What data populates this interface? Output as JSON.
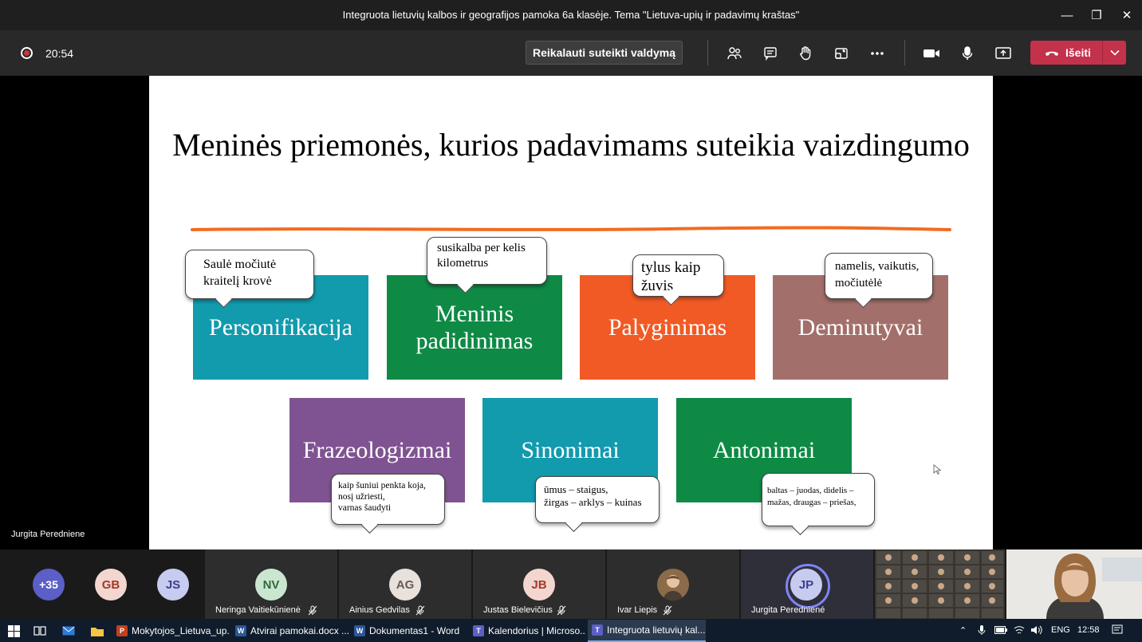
{
  "window": {
    "title": "Integruota lietuvių kalbos ir geografijos pamoka 6a klasėje. Tema \"Lietuva-upių ir padavimų kraštas\"",
    "minimize": "—",
    "maximize": "❐",
    "close": "✕"
  },
  "meeting": {
    "timer": "20:54",
    "request_control_label": "Reikalauti suteikti valdymą",
    "leave_label": "Išeiti"
  },
  "slide": {
    "title": "Meninės priemonės, kurios padavimams suteikia vaizdingumo",
    "boxes": [
      {
        "label": "Personifikacija",
        "color": "#129aad"
      },
      {
        "label": "Meninis padidinimas",
        "color": "#0e8a45"
      },
      {
        "label": "Palyginimas",
        "color": "#f15a24"
      },
      {
        "label": "Deminutyvai",
        "color": "#a36f6a"
      },
      {
        "label": "Frazeologizmai",
        "color": "#7f5391"
      },
      {
        "label": "Sinonimai",
        "color": "#129aad"
      },
      {
        "label": "Antonimai",
        "color": "#0e8a45"
      }
    ],
    "bubbles": [
      "Saulė močiutė\nkraitelį krovė",
      "susikalba per kelis\nkilometrus",
      "tylus kaip\nžuvis",
      "namelis, vaikutis,\nmočiutėlė",
      "kaip šuniui penkta koja,\nnosį užriesti,\nvarnas šaudyti",
      "ūmus – staigus,\nžirgas – arklys – kuinas",
      "baltas – juodas, didelis –\nmažas, draugas – priešas,"
    ],
    "underline_color": "#f26b21"
  },
  "presenter_name": "Jurgita Peredniene",
  "participants": {
    "more_count": "+35",
    "avatars": [
      {
        "initials": "GB",
        "bg": "#f3d6cf",
        "fg": "#a23a2a"
      },
      {
        "initials": "JS",
        "bg": "#c7cbef",
        "fg": "#3a3e8f"
      }
    ],
    "tiles": [
      {
        "initials": "NV",
        "name": "Neringa Vaitiekūnienė",
        "bg": "#cbe6d0",
        "fg": "#2e6a3b"
      },
      {
        "initials": "AG",
        "name": "Ainius Gedvilas",
        "bg": "#e8e1dc",
        "fg": "#6b5a4f"
      },
      {
        "initials": "JB",
        "name": "Justas Bielevičius",
        "bg": "#f3d6cf",
        "fg": "#a23a2a"
      },
      {
        "initials": "",
        "name": "Ivar Liepis",
        "bg": "#b8946a",
        "fg": "#fff"
      },
      {
        "initials": "JP",
        "name": "Jurgita Peredniené",
        "bg": "#c7cbef",
        "fg": "#3a3e8f"
      }
    ]
  },
  "taskbar": {
    "apps": [
      {
        "label": "Mokytojos_Lietuva_up...",
        "icon": "P",
        "color": "#c43e1c"
      },
      {
        "label": "Atvirai pamokai.docx ...",
        "icon": "W",
        "color": "#2b579a"
      },
      {
        "label": "Dokumentas1 - Word",
        "icon": "W",
        "color": "#2b579a"
      },
      {
        "label": "Kalendorius | Microso...",
        "icon": "T",
        "color": "#5b5fc7"
      },
      {
        "label": "Integruota lietuvių kal...",
        "icon": "T",
        "color": "#5b5fc7"
      }
    ],
    "language": "ENG",
    "time": "12:58"
  }
}
